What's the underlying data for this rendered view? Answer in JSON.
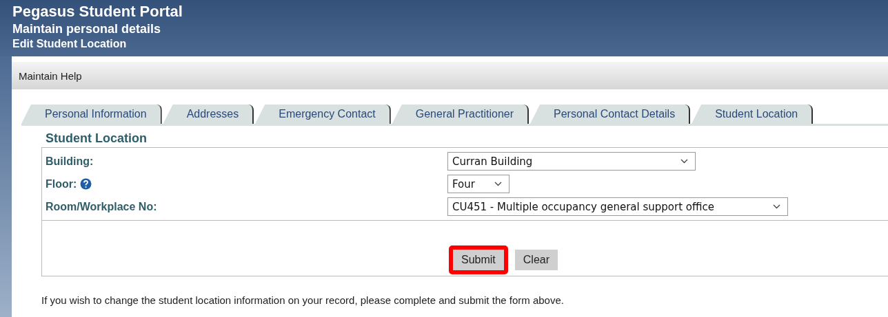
{
  "header": {
    "title": "Pegasus Student Portal",
    "subtitle": "Maintain personal details",
    "page": "Edit Student Location"
  },
  "menu": [
    "Maintain Help"
  ],
  "tabs": [
    {
      "label": "Personal Information"
    },
    {
      "label": "Addresses"
    },
    {
      "label": "Emergency Contact"
    },
    {
      "label": "General Practitioner"
    },
    {
      "label": "Personal Contact Details"
    },
    {
      "label": "Student Location"
    }
  ],
  "section_title": "Student Location",
  "fields": [
    {
      "label": "Building:",
      "help": false,
      "value": "Curran Building"
    },
    {
      "label": "Floor:",
      "help": true,
      "value": "Four"
    },
    {
      "label": "Room/Workplace No:",
      "help": false,
      "value": "CU451 - Multiple occupancy general support office"
    }
  ],
  "buttons": [
    {
      "label": "Submit",
      "highlighted": true
    },
    {
      "label": "Clear",
      "highlighted": false
    }
  ],
  "note": "If you wish to change the student location information on your record, please complete and submit the form above."
}
